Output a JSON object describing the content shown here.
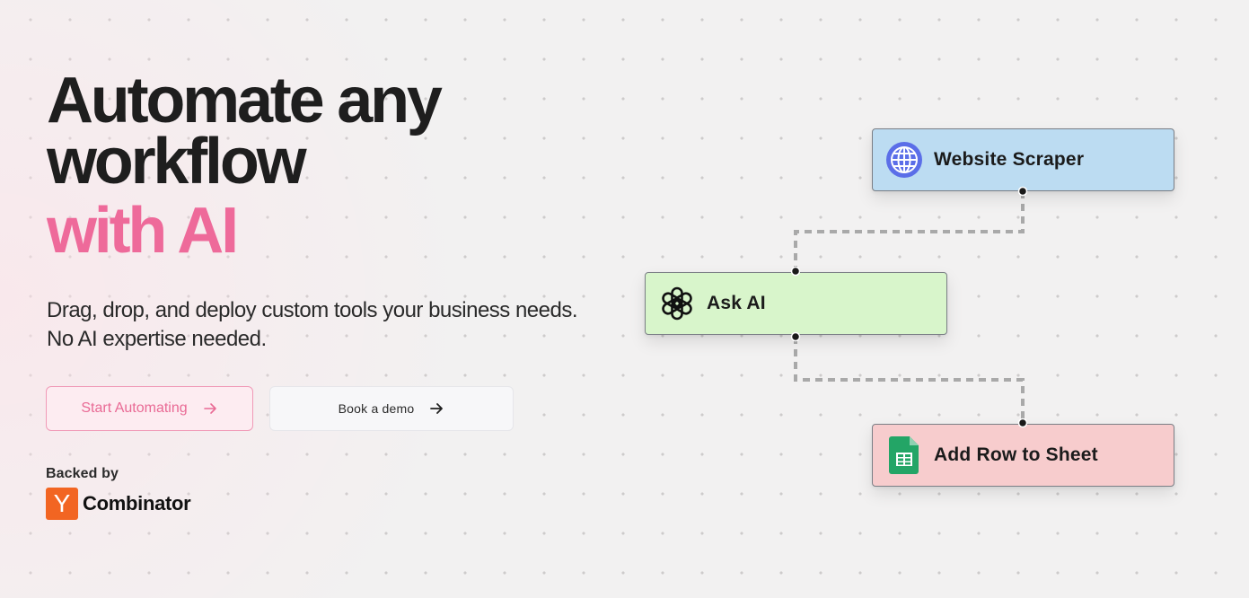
{
  "hero": {
    "title_line1": "Automate any",
    "title_line2": "workflow",
    "title_accent": "with AI",
    "subtitle_line1": "Drag, drop, and deploy custom tools your business needs.",
    "subtitle_line2": "No AI expertise needed."
  },
  "buttons": {
    "primary_label": "Start Automating",
    "secondary_label": "Book a demo",
    "primary_icon": "arrow-right-icon",
    "secondary_icon": "arrow-right-icon"
  },
  "backing": {
    "label": "Backed by",
    "logo_letter": "Y",
    "name": "Combinator"
  },
  "workflow": {
    "nodes": [
      {
        "label": "Website Scraper",
        "icon": "globe-icon",
        "color": "#bcdcf2"
      },
      {
        "label": "Ask AI",
        "icon": "openai-icon",
        "color": "#d8f5cb"
      },
      {
        "label": "Add Row to Sheet",
        "icon": "google-sheets-icon",
        "color": "#f7cccd"
      }
    ]
  },
  "colors": {
    "accent": "#ee6a9a",
    "yc_orange": "#f26522"
  }
}
